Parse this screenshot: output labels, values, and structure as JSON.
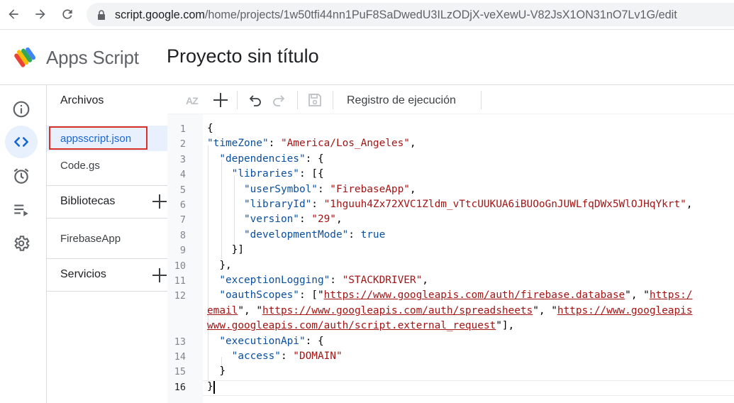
{
  "browser": {
    "url_host": "script.google.com",
    "url_path": "/home/projects/1w50tfi44nn1PuF8SaDwedU3ILzODjX-veXewU-V82JsX1ON31nO7Lv1G/edit"
  },
  "header": {
    "product_name": "Apps Script",
    "project_title": "Proyecto sin título"
  },
  "rail": {
    "items": [
      {
        "name": "overview",
        "icon": "info-icon"
      },
      {
        "name": "editor",
        "icon": "code-icon",
        "active": true
      },
      {
        "name": "triggers",
        "icon": "alarm-clock-icon"
      },
      {
        "name": "executions",
        "icon": "executions-list-icon"
      },
      {
        "name": "settings",
        "icon": "gear-icon"
      }
    ]
  },
  "files_panel": {
    "files_title": "Archivos",
    "files": [
      {
        "label": "appsscript.json",
        "selected": true
      },
      {
        "label": "Code.gs"
      }
    ],
    "libraries_title": "Bibliotecas",
    "libraries": [
      {
        "label": "FirebaseApp"
      }
    ],
    "services_title": "Servicios"
  },
  "toolbar": {
    "execution_log_label": "Registro de ejecución",
    "sort_icon": "AZ"
  },
  "editor": {
    "line_numbers": [
      "1",
      "2",
      "3",
      "4",
      "5",
      "6",
      "7",
      "8",
      "9",
      "10",
      "11",
      "12",
      "13",
      "14",
      "15",
      "16"
    ],
    "current_line": "16",
    "lines": [
      [
        {
          "t": "p",
          "v": "{"
        }
      ],
      [
        {
          "t": "k",
          "v": "\"timeZone\""
        },
        {
          "t": "p",
          "v": ": "
        },
        {
          "t": "s",
          "v": "\"America/Los_Angeles\""
        },
        {
          "t": "p",
          "v": ","
        }
      ],
      [
        {
          "t": "p",
          "v": "  "
        },
        {
          "t": "k",
          "v": "\"dependencies\""
        },
        {
          "t": "p",
          "v": ": {"
        }
      ],
      [
        {
          "t": "p",
          "v": "    "
        },
        {
          "t": "k",
          "v": "\"libraries\""
        },
        {
          "t": "p",
          "v": ": [{"
        }
      ],
      [
        {
          "t": "p",
          "v": "      "
        },
        {
          "t": "k",
          "v": "\"userSymbol\""
        },
        {
          "t": "p",
          "v": ": "
        },
        {
          "t": "s",
          "v": "\"FirebaseApp\""
        },
        {
          "t": "p",
          "v": ","
        }
      ],
      [
        {
          "t": "p",
          "v": "      "
        },
        {
          "t": "k",
          "v": "\"libraryId\""
        },
        {
          "t": "p",
          "v": ": "
        },
        {
          "t": "s",
          "v": "\"1hguuh4Zx72XVC1Zldm_vTtcUUKUA6iBUOoGnJUWLfqDWx5WlOJHqYkrt\""
        },
        {
          "t": "p",
          "v": ","
        }
      ],
      [
        {
          "t": "p",
          "v": "      "
        },
        {
          "t": "k",
          "v": "\"version\""
        },
        {
          "t": "p",
          "v": ": "
        },
        {
          "t": "s",
          "v": "\"29\""
        },
        {
          "t": "p",
          "v": ","
        }
      ],
      [
        {
          "t": "p",
          "v": "      "
        },
        {
          "t": "k",
          "v": "\"developmentMode\""
        },
        {
          "t": "p",
          "v": ": "
        },
        {
          "t": "kw",
          "v": "true"
        }
      ],
      [
        {
          "t": "p",
          "v": "    }]"
        }
      ],
      [
        {
          "t": "p",
          "v": "  },"
        }
      ],
      [
        {
          "t": "p",
          "v": "  "
        },
        {
          "t": "k",
          "v": "\"exceptionLogging\""
        },
        {
          "t": "p",
          "v": ": "
        },
        {
          "t": "s",
          "v": "\"STACKDRIVER\""
        },
        {
          "t": "p",
          "v": ","
        }
      ],
      [
        {
          "t": "p",
          "v": "  "
        },
        {
          "t": "k",
          "v": "\"oauthScopes\""
        },
        {
          "t": "p",
          "v": ": [\""
        },
        {
          "t": "u",
          "v": "https://www.googleapis.com/auth/firebase.database"
        },
        {
          "t": "p",
          "v": "\", \""
        },
        {
          "t": "u",
          "v": "https:/"
        }
      ],
      [
        {
          "t": "u",
          "v": "email"
        },
        {
          "t": "p",
          "v": "\", \""
        },
        {
          "t": "u",
          "v": "https://www.googleapis.com/auth/spreadsheets"
        },
        {
          "t": "p",
          "v": "\", \""
        },
        {
          "t": "u",
          "v": "https://www.googleapis"
        }
      ],
      [
        {
          "t": "u",
          "v": "www.googleapis.com/auth/script.external_request"
        },
        {
          "t": "p",
          "v": "\"],"
        }
      ],
      [
        {
          "t": "p",
          "v": "  "
        },
        {
          "t": "k",
          "v": "\"executionApi\""
        },
        {
          "t": "p",
          "v": ": {"
        }
      ],
      [
        {
          "t": "p",
          "v": "    "
        },
        {
          "t": "k",
          "v": "\"access\""
        },
        {
          "t": "p",
          "v": ": "
        },
        {
          "t": "s",
          "v": "\"DOMAIN\""
        }
      ],
      [
        {
          "t": "p",
          "v": "  }"
        }
      ],
      [
        {
          "t": "p",
          "v": "}"
        }
      ]
    ]
  }
}
